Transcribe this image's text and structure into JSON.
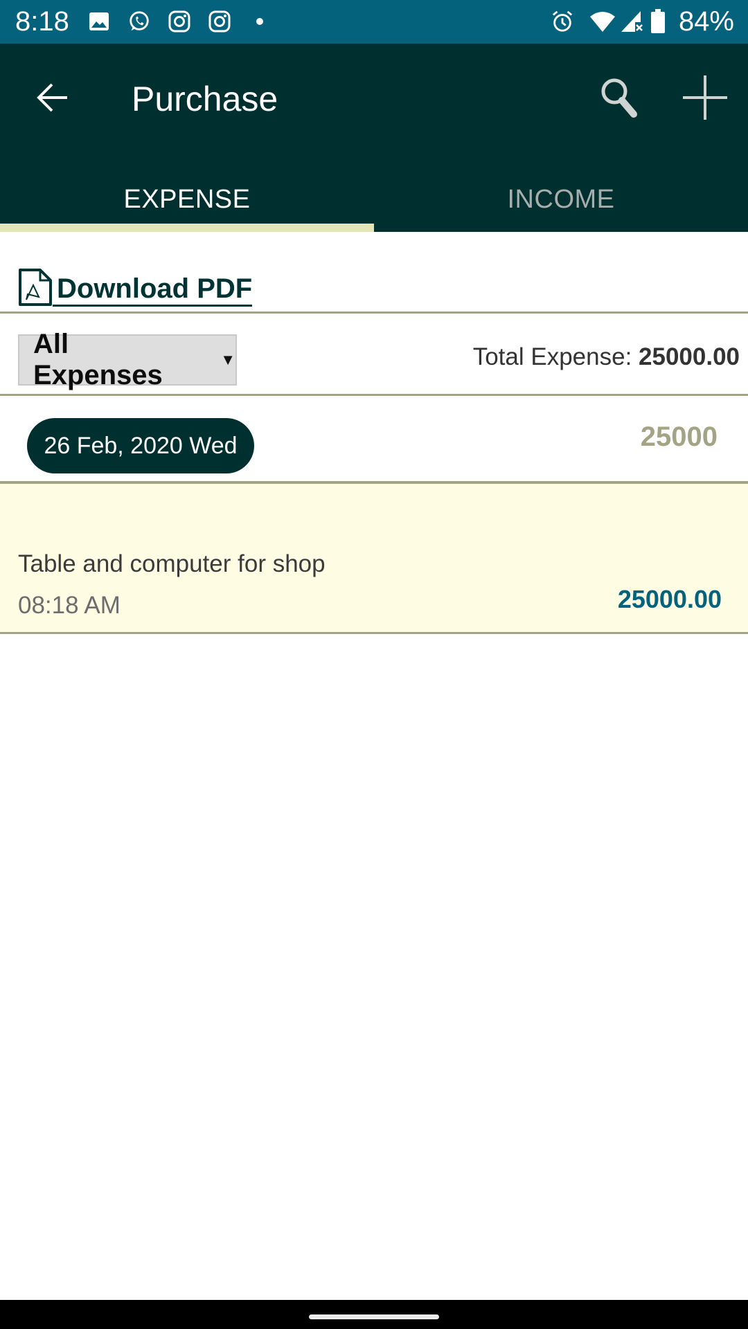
{
  "status_bar": {
    "time": "8:18",
    "left_icons": [
      "gallery-icon",
      "whatsapp-icon",
      "instagram-icon",
      "instagram-icon",
      "dot-icon"
    ],
    "right_icons": [
      "alarm-icon",
      "wifi-icon",
      "signal-no-data-icon",
      "battery-icon"
    ],
    "battery_percent": "84%"
  },
  "app_bar": {
    "title": "Purchase",
    "back_icon": "arrow-left-icon",
    "actions": [
      "search-icon",
      "plus-icon"
    ]
  },
  "tabs": [
    {
      "label": "EXPENSE",
      "active": true
    },
    {
      "label": "INCOME",
      "active": false
    }
  ],
  "download": {
    "label": " Download PDF",
    "icon": "pdf-file-icon"
  },
  "filter": {
    "selected": "All Expenses",
    "caret": "▼",
    "total_label": "Total Expense: ",
    "total_value": "25000.00"
  },
  "groups": [
    {
      "date": "26 Feb, 2020 Wed",
      "total": "25000",
      "items": [
        {
          "description": "Table and computer for shop",
          "time": "08:18 AM",
          "amount": "25000.00"
        }
      ]
    }
  ],
  "colors": {
    "status_bar": "#05627c",
    "app_bar": "#002f2f",
    "tab_indicator": "#e4e4b4",
    "divider": "#a3a385",
    "item_bg": "#fefde3",
    "amount": "#05627c"
  }
}
